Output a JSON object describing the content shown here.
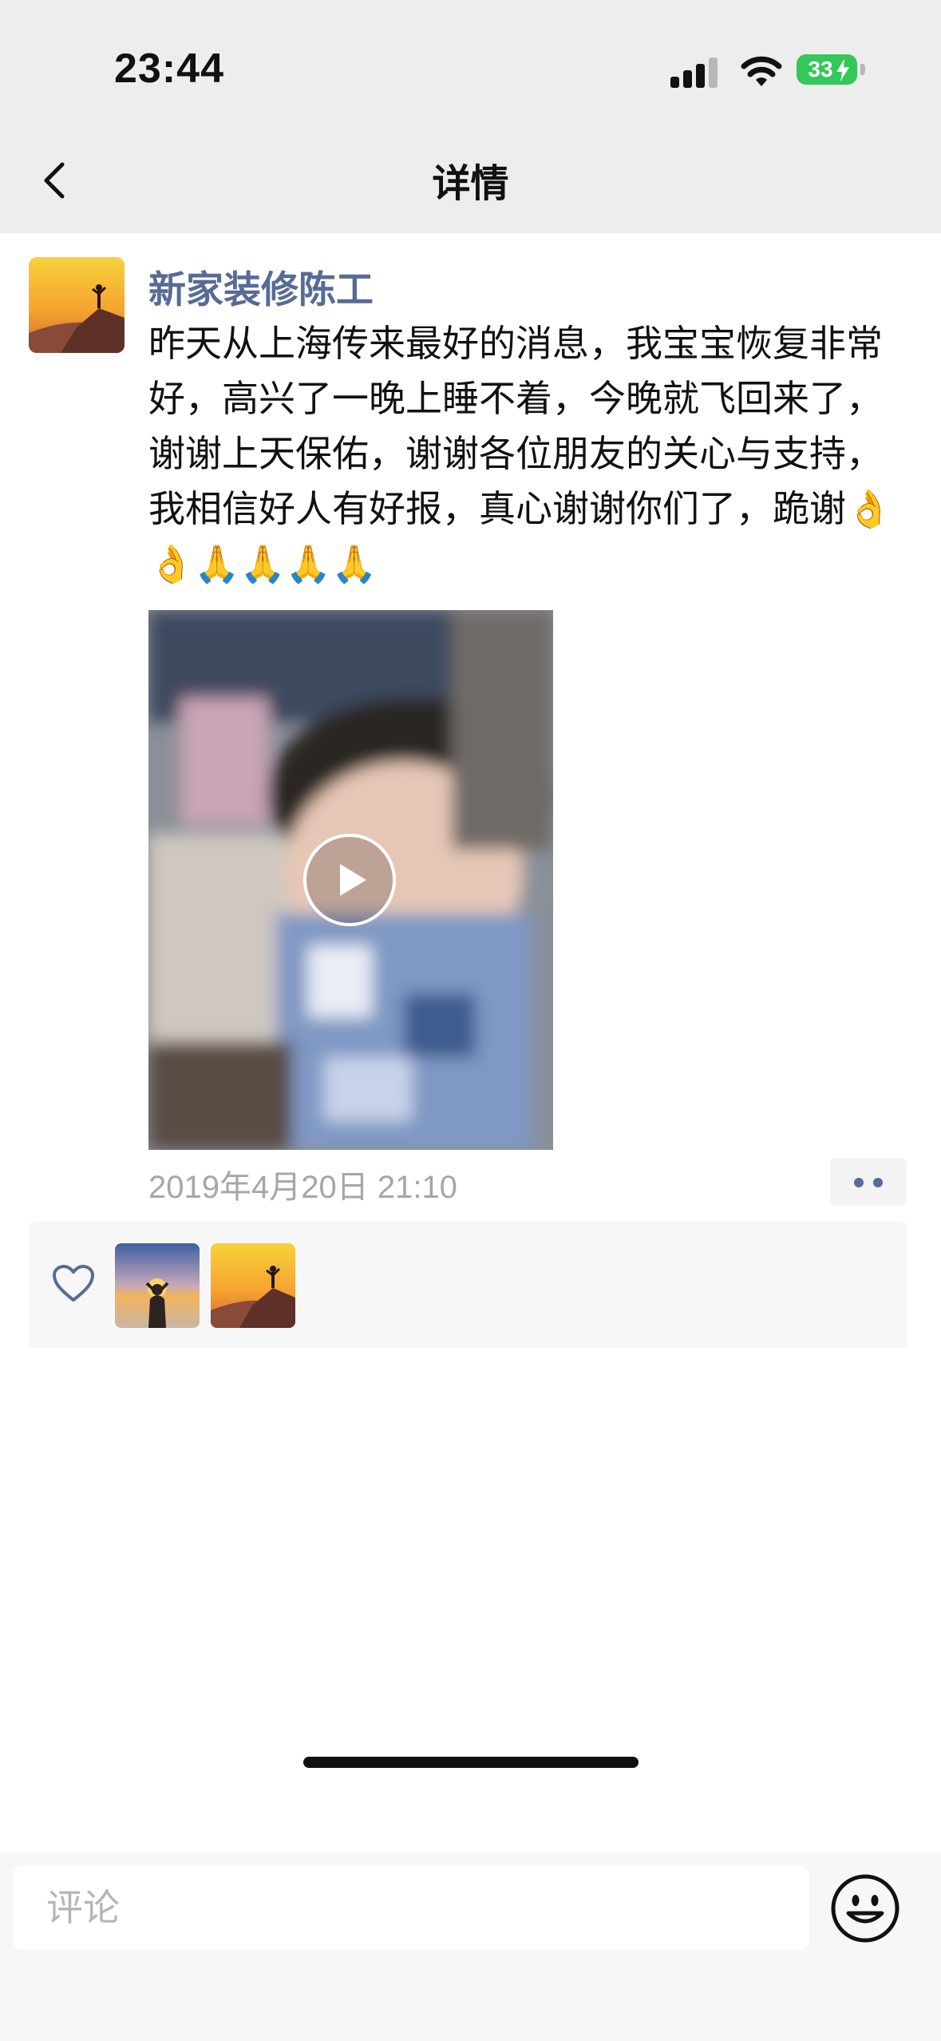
{
  "status_bar": {
    "time": "23:44",
    "battery": "33"
  },
  "nav": {
    "title": "详情",
    "back_icon": "chevron-left-icon"
  },
  "post": {
    "author": "新家装修陈工",
    "text": "昨天从上海传来最好的消息，我宝宝恢复非常好，高兴了一晚上睡不着，今晚就飞回来了，谢谢上天保佑，谢谢各位朋友的关心与支持，我相信好人有好报，真心谢谢你们了，跪谢👌👌🙏🙏🙏🙏",
    "time": "2019年4月20日 21:10",
    "video_icon": "play-icon",
    "more_icon": "more-dots-icon"
  },
  "likes": {
    "icon": "heart-icon"
  },
  "comment_bar": {
    "placeholder": "评论",
    "emoji_icon": "smiley-icon"
  },
  "colors": {
    "name_link": "#576b95",
    "top_bar_bg": "#ededed",
    "time_gray": "#a6a6a6"
  }
}
